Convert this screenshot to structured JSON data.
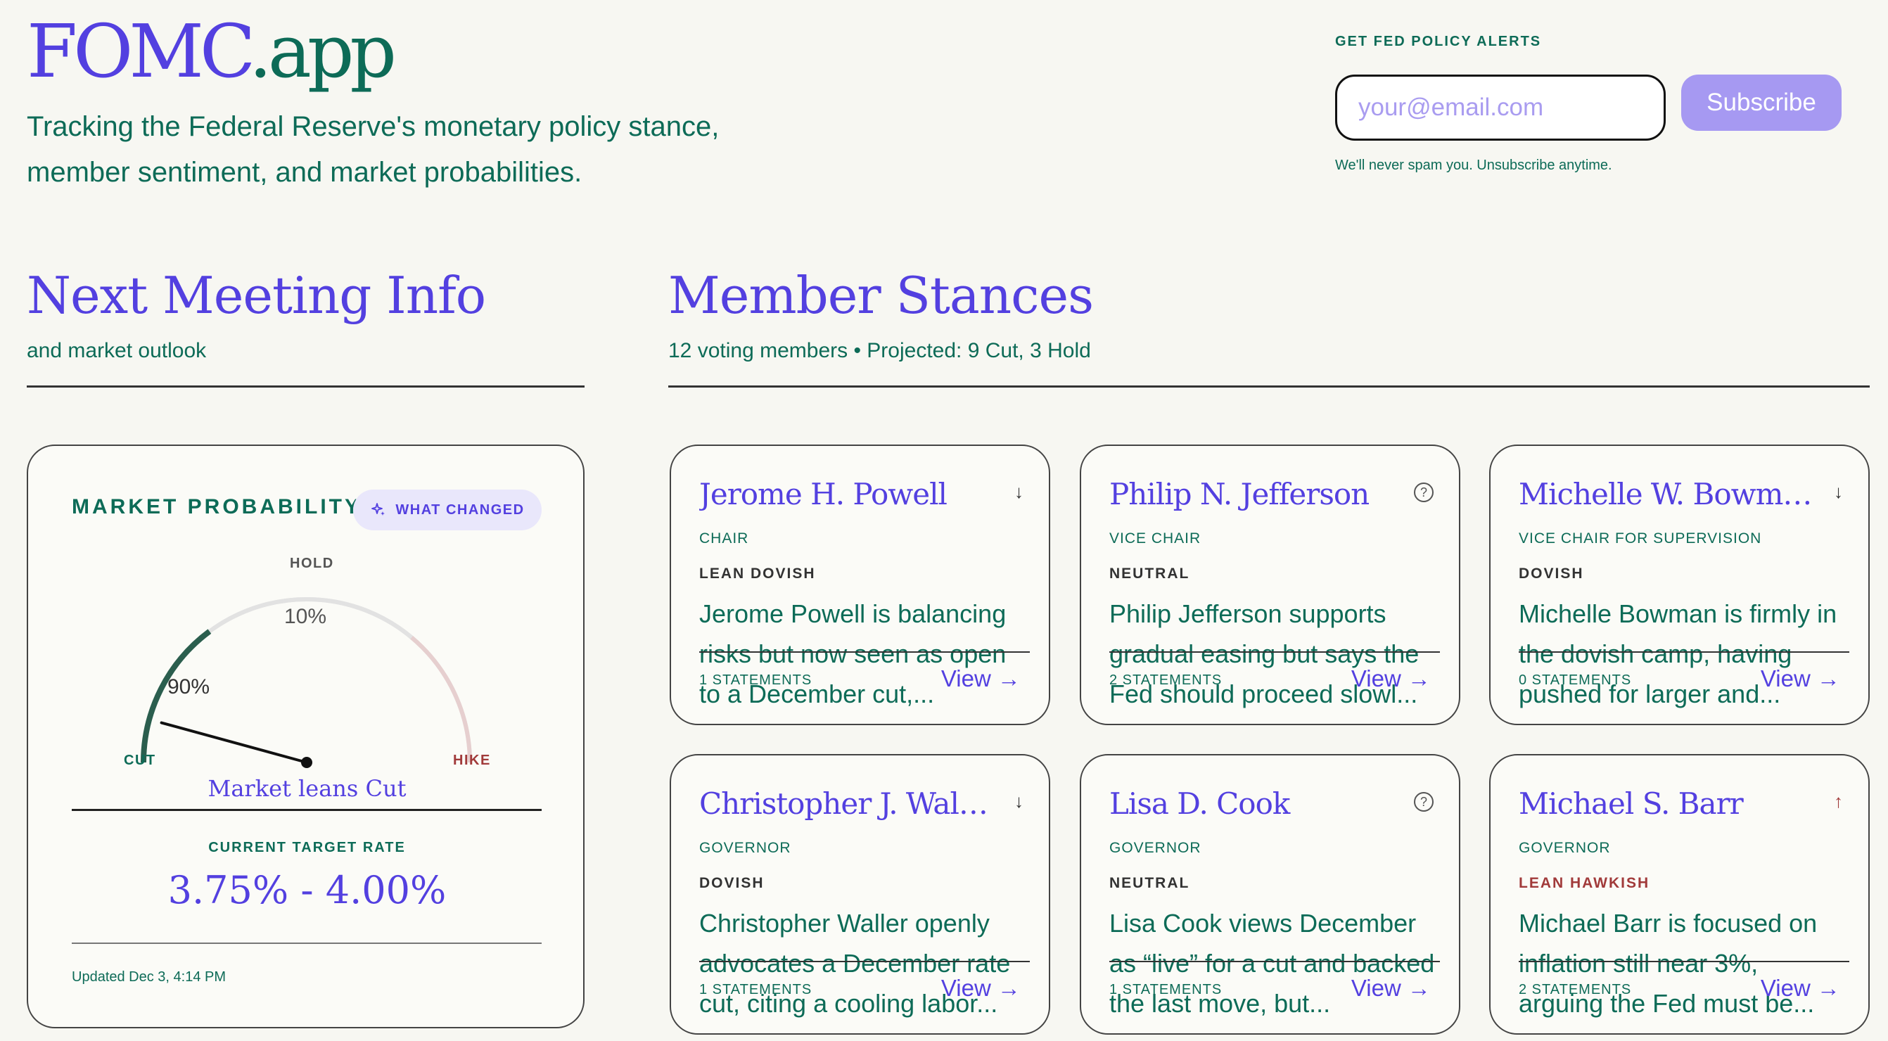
{
  "header": {
    "logo_main": "FOMC",
    "logo_suffix": ".app",
    "tagline": "Tracking the Federal Reserve's monetary policy stance, member sentiment, and market probabilities."
  },
  "alerts": {
    "title": "GET FED POLICY ALERTS",
    "email_placeholder": "your@email.com",
    "subscribe_label": "Subscribe",
    "disclaimer": "We'll never spam you. Unsubscribe anytime."
  },
  "next_meeting": {
    "title": "Next Meeting Info",
    "subtitle": "and market outlook"
  },
  "market": {
    "title": "MARKET PROBABILITY",
    "what_changed_label": "WHAT CHANGED",
    "hold_label": "HOLD",
    "cut_label": "CUT",
    "hike_label": "HIKE",
    "cut_probability": 90,
    "hold_probability": 10,
    "hike_probability": 0,
    "cut_pct_text": "90%",
    "hold_pct_text": "10%",
    "lean_text": "Market leans Cut",
    "current_rate_label": "CURRENT TARGET RATE",
    "current_rate_value": "3.75% - 4.00%",
    "updated": "Updated Dec 3, 4:14 PM",
    "colors": {
      "cut": "#2b5e4e",
      "hold": "#e2e2e2",
      "hike": "#e6cfcf",
      "needle": "#111111"
    }
  },
  "member_stances": {
    "title": "Member Stances",
    "subtitle": "12 voting members • Projected: 9 Cut, 3 Hold",
    "members": [
      {
        "name": "Jerome H. Powell",
        "role": "CHAIR",
        "stance": "LEAN DOVISH",
        "icon": "arrow-down-icon",
        "icon_glyph": "↓",
        "summary": "Jerome Powell is balancing risks but now seen as open to a December cut,...",
        "statements": "1 STATEMENTS",
        "view_label": "View →"
      },
      {
        "name": "Philip N. Jefferson",
        "role": "VICE CHAIR",
        "stance": "NEUTRAL",
        "icon": "question-circle-icon",
        "icon_glyph": "?",
        "summary": "Philip Jefferson supports gradual easing but says the Fed should proceed slowl...",
        "statements": "2 STATEMENTS",
        "view_label": "View →"
      },
      {
        "name": "Michelle W. Bowman",
        "role": "VICE CHAIR FOR SUPERVISION",
        "stance": "DOVISH",
        "icon": "arrow-down-icon",
        "icon_glyph": "↓",
        "summary": "Michelle Bowman is firmly in the dovish camp, having pushed for larger and...",
        "statements": "0 STATEMENTS",
        "view_label": "View →"
      },
      {
        "name": "Christopher J. Waller",
        "role": "GOVERNOR",
        "stance": "DOVISH",
        "icon": "arrow-down-icon",
        "icon_glyph": "↓",
        "summary": "Christopher Waller openly advocates a December rate cut, citing a cooling labor...",
        "statements": "1 STATEMENTS",
        "view_label": "View →"
      },
      {
        "name": "Lisa D. Cook",
        "role": "GOVERNOR",
        "stance": "NEUTRAL",
        "icon": "question-circle-icon",
        "icon_glyph": "?",
        "summary": "Lisa Cook views December as “live” for a cut and backed the last move, but...",
        "statements": "1 STATEMENTS",
        "view_label": "View →"
      },
      {
        "name": "Michael S. Barr",
        "role": "GOVERNOR",
        "stance": "LEAN HAWKISH",
        "icon": "arrow-up-icon",
        "icon_glyph": "↑",
        "summary": "Michael Barr is focused on inflation still near 3%, arguing the Fed must be...",
        "statements": "2 STATEMENTS",
        "view_label": "View →"
      }
    ]
  }
}
